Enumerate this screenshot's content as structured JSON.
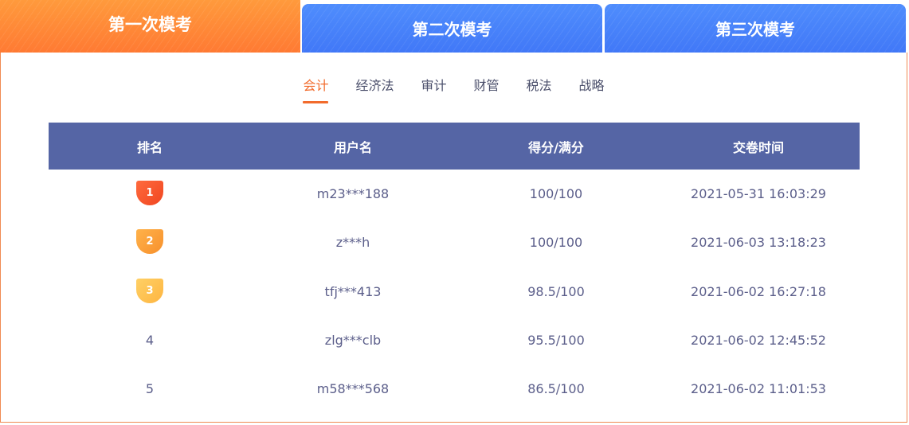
{
  "tabs": [
    {
      "label": "第一次模考",
      "active": true
    },
    {
      "label": "第二次模考",
      "active": false
    },
    {
      "label": "第三次模考",
      "active": false
    }
  ],
  "subtabs": [
    {
      "label": "会计",
      "active": true
    },
    {
      "label": "经济法",
      "active": false
    },
    {
      "label": "审计",
      "active": false
    },
    {
      "label": "财管",
      "active": false
    },
    {
      "label": "税法",
      "active": false
    },
    {
      "label": "战略",
      "active": false
    }
  ],
  "table": {
    "headers": [
      "排名",
      "用户名",
      "得分/满分",
      "交卷时间"
    ],
    "rows": [
      {
        "rank": "1",
        "user": "m23***188",
        "score": "100/100",
        "time": "2021-05-31 16:03:29"
      },
      {
        "rank": "2",
        "user": "z***h",
        "score": "100/100",
        "time": "2021-06-03 13:18:23"
      },
      {
        "rank": "3",
        "user": "tfj***413",
        "score": "98.5/100",
        "time": "2021-06-02 16:27:18"
      },
      {
        "rank": "4",
        "user": "zlg***clb",
        "score": "95.5/100",
        "time": "2021-06-02 12:45:52"
      },
      {
        "rank": "5",
        "user": "m58***568",
        "score": "86.5/100",
        "time": "2021-06-02 11:01:53"
      }
    ]
  },
  "colors": {
    "active_tab": "#ff7a33",
    "inactive_tab": "#4178f7",
    "accent": "#f26b2c",
    "table_header": "#5565a5",
    "medal_gold": "#f04621",
    "medal_silver": "#f7902c",
    "medal_bronze": "#fdb541"
  },
  "icons": {
    "rank_1": "medal-icon",
    "rank_2": "medal-icon",
    "rank_3": "medal-icon"
  }
}
